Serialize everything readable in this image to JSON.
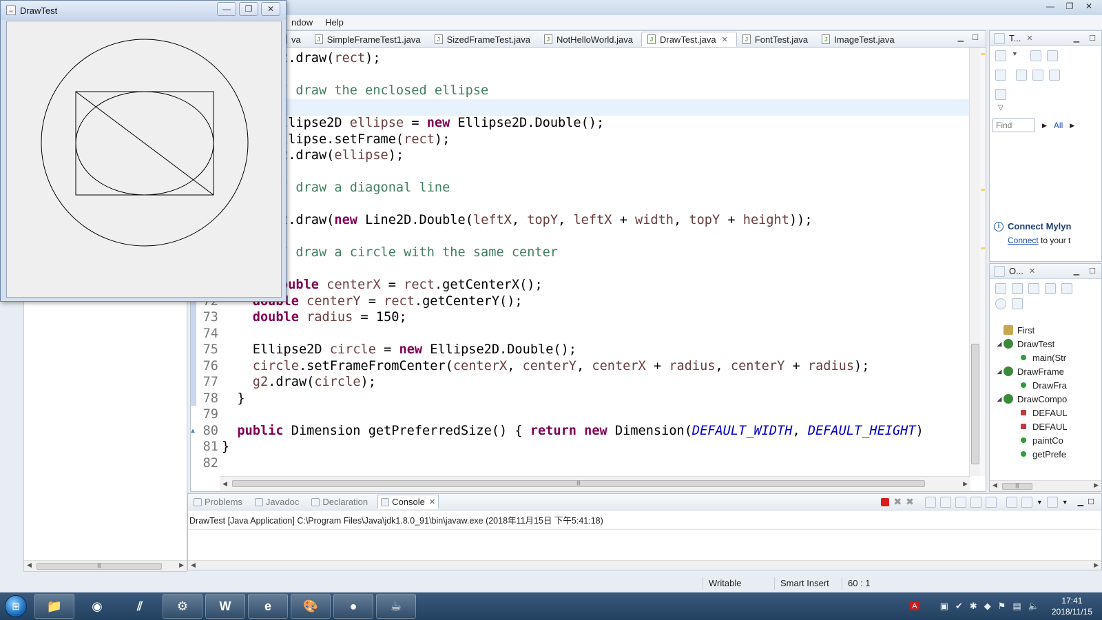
{
  "eclipse": {
    "menu": [
      "ndow",
      "Help"
    ],
    "window_controls": [
      "—",
      "❐",
      "✕"
    ]
  },
  "editor": {
    "tabs": [
      {
        "label": "va",
        "active": false
      },
      {
        "label": "SimpleFrameTest1.java",
        "active": false
      },
      {
        "label": "SizedFrameTest.java",
        "active": false
      },
      {
        "label": "NotHelloWorld.java",
        "active": false
      },
      {
        "label": "DrawTest.java",
        "active": true
      },
      {
        "label": "FontTest.java",
        "active": false
      },
      {
        "label": "ImageTest.java",
        "active": false
      }
    ],
    "code": [
      {
        "ln": "",
        "html": "2.draw(<span class=\"var\">rect</span>);"
      },
      {
        "ln": "",
        "html": ""
      },
      {
        "ln": "",
        "html": "<span class=\"cm\">/ draw the enclosed ellipse</span>"
      },
      {
        "ln": "",
        "html": ""
      },
      {
        "ln": "",
        "html": "llipse2D <span class=\"var\">ellipse</span> = <span class=\"kw\">new</span> Ellipse2D.Double();"
      },
      {
        "ln": "",
        "html": "llipse.setFrame(<span class=\"var\">rect</span>);"
      },
      {
        "ln": "",
        "html": "2.draw(<span class=\"var\">ellipse</span>);"
      },
      {
        "ln": "",
        "html": ""
      },
      {
        "ln": "",
        "html": "<span class=\"cm\">/ draw a diagonal line</span>"
      },
      {
        "ln": "",
        "html": ""
      },
      {
        "ln": "",
        "html": "2.draw(<span class=\"kw\">new</span> Line2D.Double(<span class=\"var\">leftX</span>, <span class=\"var\">topY</span>, <span class=\"var\">leftX</span> + <span class=\"var\">width</span>, <span class=\"var\">topY</span> + <span class=\"var\">height</span>));"
      },
      {
        "ln": "",
        "html": ""
      },
      {
        "ln": "",
        "html": "<span class=\"cm\">/ draw a circle with the same center</span>"
      },
      {
        "ln": "",
        "html": ""
      },
      {
        "ln": "",
        "html": "<span class=\"kw\">ouble</span> <span class=\"var\">centerX</span> = <span class=\"var\">rect</span>.getCenterX();"
      },
      {
        "ln": "72",
        "html": "    <span class=\"kw\">double</span> <span class=\"var\">centerY</span> = <span class=\"var\">rect</span>.getCenterY();"
      },
      {
        "ln": "73",
        "html": "    <span class=\"kw\">double</span> <span class=\"var\">radius</span> = 150;"
      },
      {
        "ln": "74",
        "html": ""
      },
      {
        "ln": "75",
        "html": "    Ellipse2D <span class=\"var\">circle</span> = <span class=\"kw\">new</span> Ellipse2D.Double();"
      },
      {
        "ln": "76",
        "html": "    <span class=\"var\">circle</span>.setFrameFromCenter(<span class=\"var\">centerX</span>, <span class=\"var\">centerY</span>, <span class=\"var\">centerX</span> + <span class=\"var\">radius</span>, <span class=\"var\">centerY</span> + <span class=\"var\">radius</span>);"
      },
      {
        "ln": "77",
        "html": "    <span class=\"var\">g2</span>.draw(<span class=\"var\">circle</span>);"
      },
      {
        "ln": "78",
        "html": "  }"
      },
      {
        "ln": "79",
        "html": ""
      },
      {
        "ln": "80",
        "html": "  <span class=\"kw\">public</span> Dimension getPreferredSize() { <span class=\"kw\">return</span> <span class=\"kw\">new</span> Dimension(<span class=\"const\">DEFAULT_WIDTH</span>, <span class=\"const\">DEFAULT_HEIGHT</span>)"
      },
      {
        "ln": "81",
        "html": "}"
      },
      {
        "ln": "82",
        "html": ""
      }
    ]
  },
  "task_view": {
    "title": "T...",
    "find_placeholder": "Find",
    "all_label": "All",
    "mylyn_title": "Connect Mylyn",
    "mylyn_link": "Connect",
    "mylyn_text": " to your t"
  },
  "outline_view": {
    "title": "O...",
    "items": [
      {
        "label": "First",
        "kind": "pkg",
        "indent": 0,
        "twisty": ""
      },
      {
        "label": "DrawTest",
        "kind": "cls",
        "indent": 0,
        "twisty": "◢"
      },
      {
        "label": "main(Str",
        "kind": "meth",
        "indent": 1,
        "twisty": ""
      },
      {
        "label": "DrawFrame",
        "kind": "cls",
        "indent": 0,
        "twisty": "◢"
      },
      {
        "label": "DrawFra",
        "kind": "meth",
        "indent": 1,
        "twisty": ""
      },
      {
        "label": "DrawCompo",
        "kind": "cls",
        "indent": 0,
        "twisty": "◢"
      },
      {
        "label": "DEFAUL",
        "kind": "field",
        "indent": 1,
        "twisty": ""
      },
      {
        "label": "DEFAUL",
        "kind": "field",
        "indent": 1,
        "twisty": ""
      },
      {
        "label": "paintCo",
        "kind": "meth",
        "indent": 1,
        "twisty": ""
      },
      {
        "label": "getPrefe",
        "kind": "meth",
        "indent": 1,
        "twisty": ""
      }
    ]
  },
  "console_view": {
    "tabs": [
      {
        "label": "Problems",
        "active": false
      },
      {
        "label": "Javadoc",
        "active": false
      },
      {
        "label": "Declaration",
        "active": false
      },
      {
        "label": "Console",
        "active": true
      }
    ],
    "launch_line": "DrawTest [Java Application] C:\\Program Files\\Java\\jdk1.8.0_91\\bin\\javaw.exe (2018年11月15日 下午5:41:18)"
  },
  "statusbar": {
    "writable": "Writable",
    "insert_mode": "Smart Insert",
    "position": "60 : 1"
  },
  "drawtest_window": {
    "title": "DrawTest",
    "controls": [
      "—",
      "❐",
      "✕"
    ]
  },
  "taskbar": {
    "apps": [
      "explorer-icon",
      "chrome-icon",
      "winrar-icon",
      "java-ee-ide-icon",
      "word-icon",
      "ie-icon",
      "paint-icon",
      "app-icon",
      "java-icon"
    ],
    "clock_time": "17:41",
    "clock_date": "2018/11/15"
  }
}
